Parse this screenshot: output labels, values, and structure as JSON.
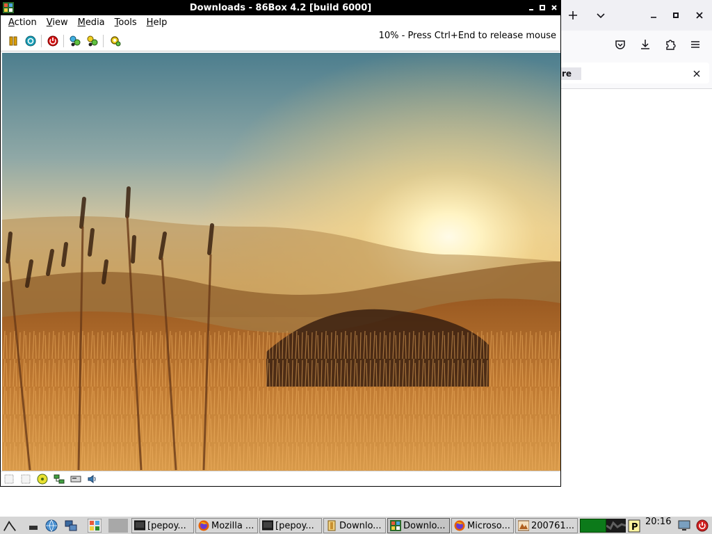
{
  "window": {
    "title": "Downloads - 86Box 4.2 [build 6000]"
  },
  "menubar": {
    "items": [
      {
        "prefix": "",
        "mnemonic": "A",
        "rest": "ction"
      },
      {
        "prefix": "",
        "mnemonic": "V",
        "rest": "iew"
      },
      {
        "prefix": "",
        "mnemonic": "M",
        "rest": "edia"
      },
      {
        "prefix": "",
        "mnemonic": "T",
        "rest": "ools"
      },
      {
        "prefix": "",
        "mnemonic": "H",
        "rest": "elp"
      }
    ]
  },
  "toolbar": {
    "status_message": "10% - Press Ctrl+End to release mouse",
    "buttons": [
      "pause-icon",
      "reset-icon",
      "power-icon",
      "ctrl-alt-del-icon",
      "ctrl-alt-esc-icon",
      "settings-icon"
    ]
  },
  "statusbar": {
    "icons": [
      "floppy-a-icon",
      "floppy-b-icon",
      "cdrom-icon",
      "network-icon",
      "hdd-icon",
      "sound-icon"
    ]
  },
  "browser": {
    "find_text": "re"
  },
  "taskbar": {
    "buttons": [
      {
        "label": "[pepoy...",
        "icon": "terminal-icon"
      },
      {
        "label": "Mozilla ...",
        "icon": "firefox-icon"
      },
      {
        "label": "[pepoy...",
        "icon": "terminal-icon"
      },
      {
        "label": "Downlo...",
        "icon": "folder-icon"
      },
      {
        "label": "Downlo...",
        "icon": "86box-icon"
      },
      {
        "label": "Microso...",
        "icon": "firefox-icon"
      },
      {
        "label": "200761...",
        "icon": "image-viewer-icon"
      }
    ],
    "clock": "20:16"
  },
  "colors": {
    "titlebar": "#000000",
    "taskbar": "#d6d6d6",
    "cpu_meter": "#0c7a1a"
  }
}
